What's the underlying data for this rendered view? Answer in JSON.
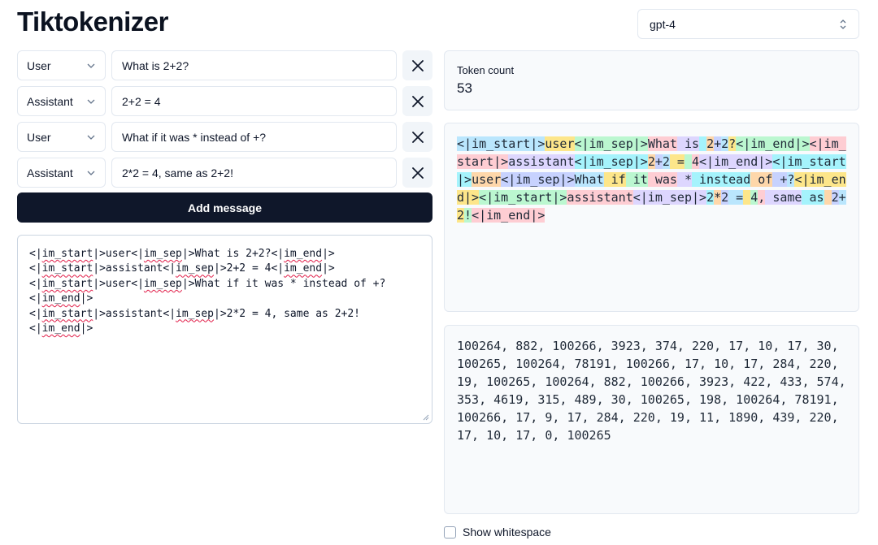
{
  "app": {
    "title": "Tiktokenizer"
  },
  "model_select": {
    "value": "gpt-4"
  },
  "messages": [
    {
      "role": "User",
      "content": "What is 2+2?"
    },
    {
      "role": "Assistant",
      "content": "2+2 = 4"
    },
    {
      "role": "User",
      "content": "What if it was * instead of +?"
    },
    {
      "role": "Assistant",
      "content": "2*2 = 4, same as 2+2!"
    }
  ],
  "add_message_label": "Add message",
  "raw_text_lines": [
    "<|im_start|>user<|im_sep|>What is 2+2?<|im_end|>",
    "<|im_start|>assistant<|im_sep|>2+2 = 4<|im_end|>",
    "<|im_start|>user<|im_sep|>What if it was * instead of +?",
    "<|im_end|>",
    "<|im_start|>assistant<|im_sep|>2*2 = 4, same as 2+2!<|im_end|>"
  ],
  "token_count": {
    "label": "Token count",
    "value": "53"
  },
  "token_colors": [
    "#bae6fd",
    "#fde68a",
    "#bbf7d0",
    "#fecdd3",
    "#ddd6fe",
    "#a5f3fc",
    "#fed7aa",
    "#c7d2fe"
  ],
  "tokens": [
    "<|im_start|>",
    "user",
    "<|im_sep|>",
    "What",
    " is",
    " ",
    "2",
    "+",
    "2",
    "?",
    "<|im_end|>",
    "<|im_start|>",
    "assistant",
    "<|im_sep|>",
    "2",
    "+",
    "2",
    " =",
    " ",
    "4",
    "<|im_end|>",
    "<|im_start|>",
    "user",
    "<|im_sep|>",
    "What",
    " if",
    " it",
    " was",
    " *",
    " instead",
    " of",
    " +",
    "?",
    "<|im_end|>",
    "<|im_start|>",
    "assistant",
    "<|im_sep|>",
    "2",
    "*",
    "2",
    " =",
    " ",
    "4",
    ",",
    " same",
    " as",
    " ",
    "2",
    "+",
    "2",
    "!",
    "<|im_end|>"
  ],
  "token_ids": "100264, 882, 100266, 3923, 374, 220, 17, 10, 17, 30, 100265, 100264, 78191, 100266, 17, 10, 17, 284, 220, 19, 100265, 100264, 882, 100266, 3923, 422, 433, 574, 353, 4619, 315, 489, 30, 100265, 198, 100264, 78191, 100266, 17, 9, 17, 284, 220, 19, 11, 1890, 439, 220, 17, 10, 17, 0, 100265",
  "show_whitespace_label": "Show whitespace"
}
